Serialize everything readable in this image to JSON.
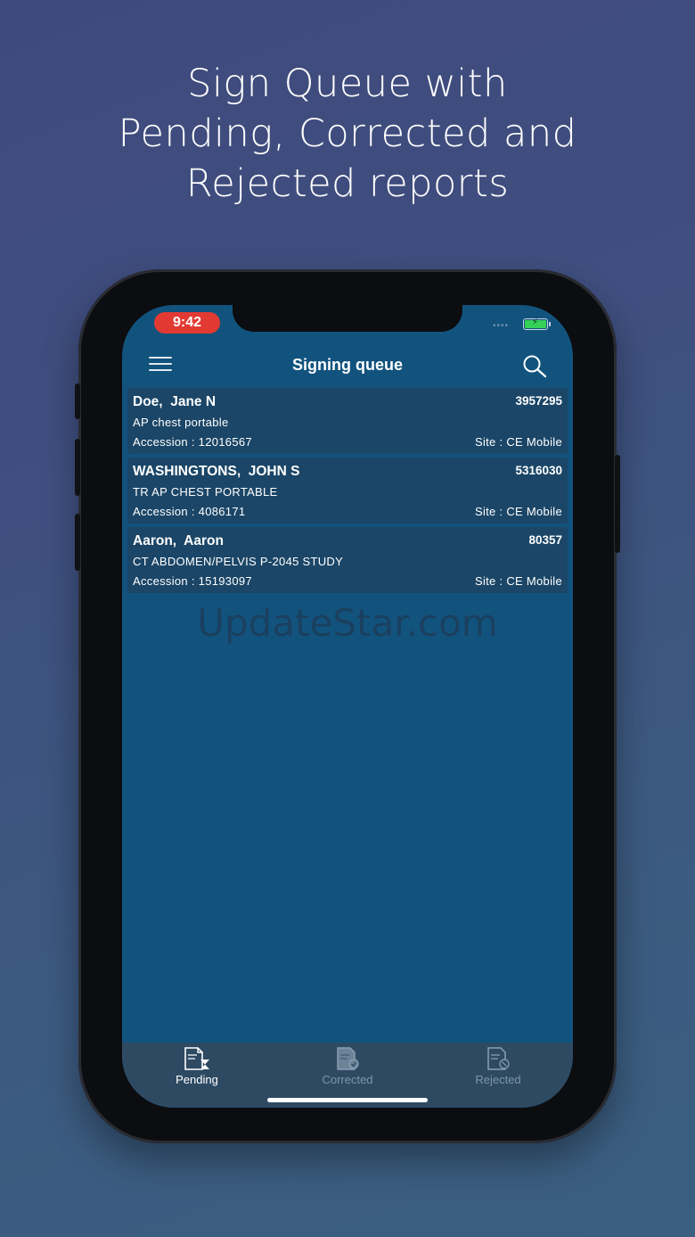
{
  "headline": {
    "line1": "Sign Queue with",
    "line2": "Pending, Corrected and",
    "line3": "Rejected reports"
  },
  "status_bar": {
    "time": "9:42"
  },
  "navbar": {
    "title": "Signing queue"
  },
  "reports": [
    {
      "name": "Doe,  Jane N",
      "mrn": "3957295",
      "study": "AP chest portable",
      "accession": "Accession : 12016567",
      "site": "Site : CE Mobile"
    },
    {
      "name": "WASHINGTONS,  JOHN S",
      "mrn": "5316030",
      "study": "TR AP CHEST PORTABLE",
      "accession": "Accession : 4086171",
      "site": "Site : CE Mobile"
    },
    {
      "name": "Aaron,  Aaron",
      "mrn": "80357",
      "study": "CT ABDOMEN/PELVIS P-2045 STUDY",
      "accession": "Accession : 15193097",
      "site": "Site : CE Mobile"
    }
  ],
  "watermark": "UpdateStar.com",
  "tabs": [
    {
      "label": "Pending",
      "icon": "pending-report-icon",
      "active": true
    },
    {
      "label": "Corrected",
      "icon": "corrected-report-icon",
      "active": false
    },
    {
      "label": "Rejected",
      "icon": "rejected-report-icon",
      "active": false
    }
  ],
  "colors": {
    "screen_bg": "#12537e",
    "row_bg": "#1b4667",
    "tabbar_bg": "#2e4a63",
    "time_pill": "#e23a32",
    "active_tab": "#ffffff",
    "inactive_tab": "#7f95a8"
  }
}
